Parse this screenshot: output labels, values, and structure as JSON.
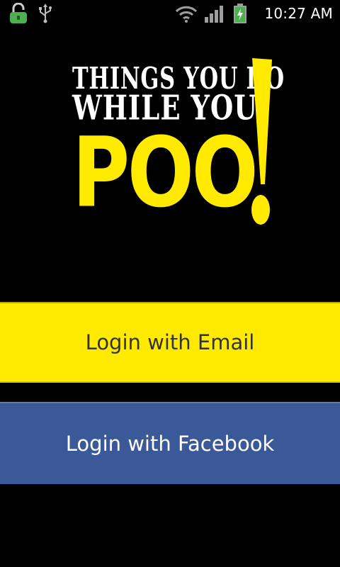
{
  "status_bar": {
    "time": "10:27 AM",
    "icons": [
      "lock-icon",
      "usb-icon",
      "wifi-icon",
      "signal-icon",
      "battery-icon"
    ]
  },
  "logo": {
    "line1": "THINGS YOU DO",
    "line2": "WHILE YOU",
    "word": "POO"
  },
  "buttons": {
    "email": "Login with Email",
    "facebook": "Login with Facebook"
  },
  "colors": {
    "background": "#000000",
    "accent_yellow": "#ffea00",
    "facebook_blue": "#3b5998",
    "email_text": "#333333",
    "facebook_text": "#ffffff"
  }
}
